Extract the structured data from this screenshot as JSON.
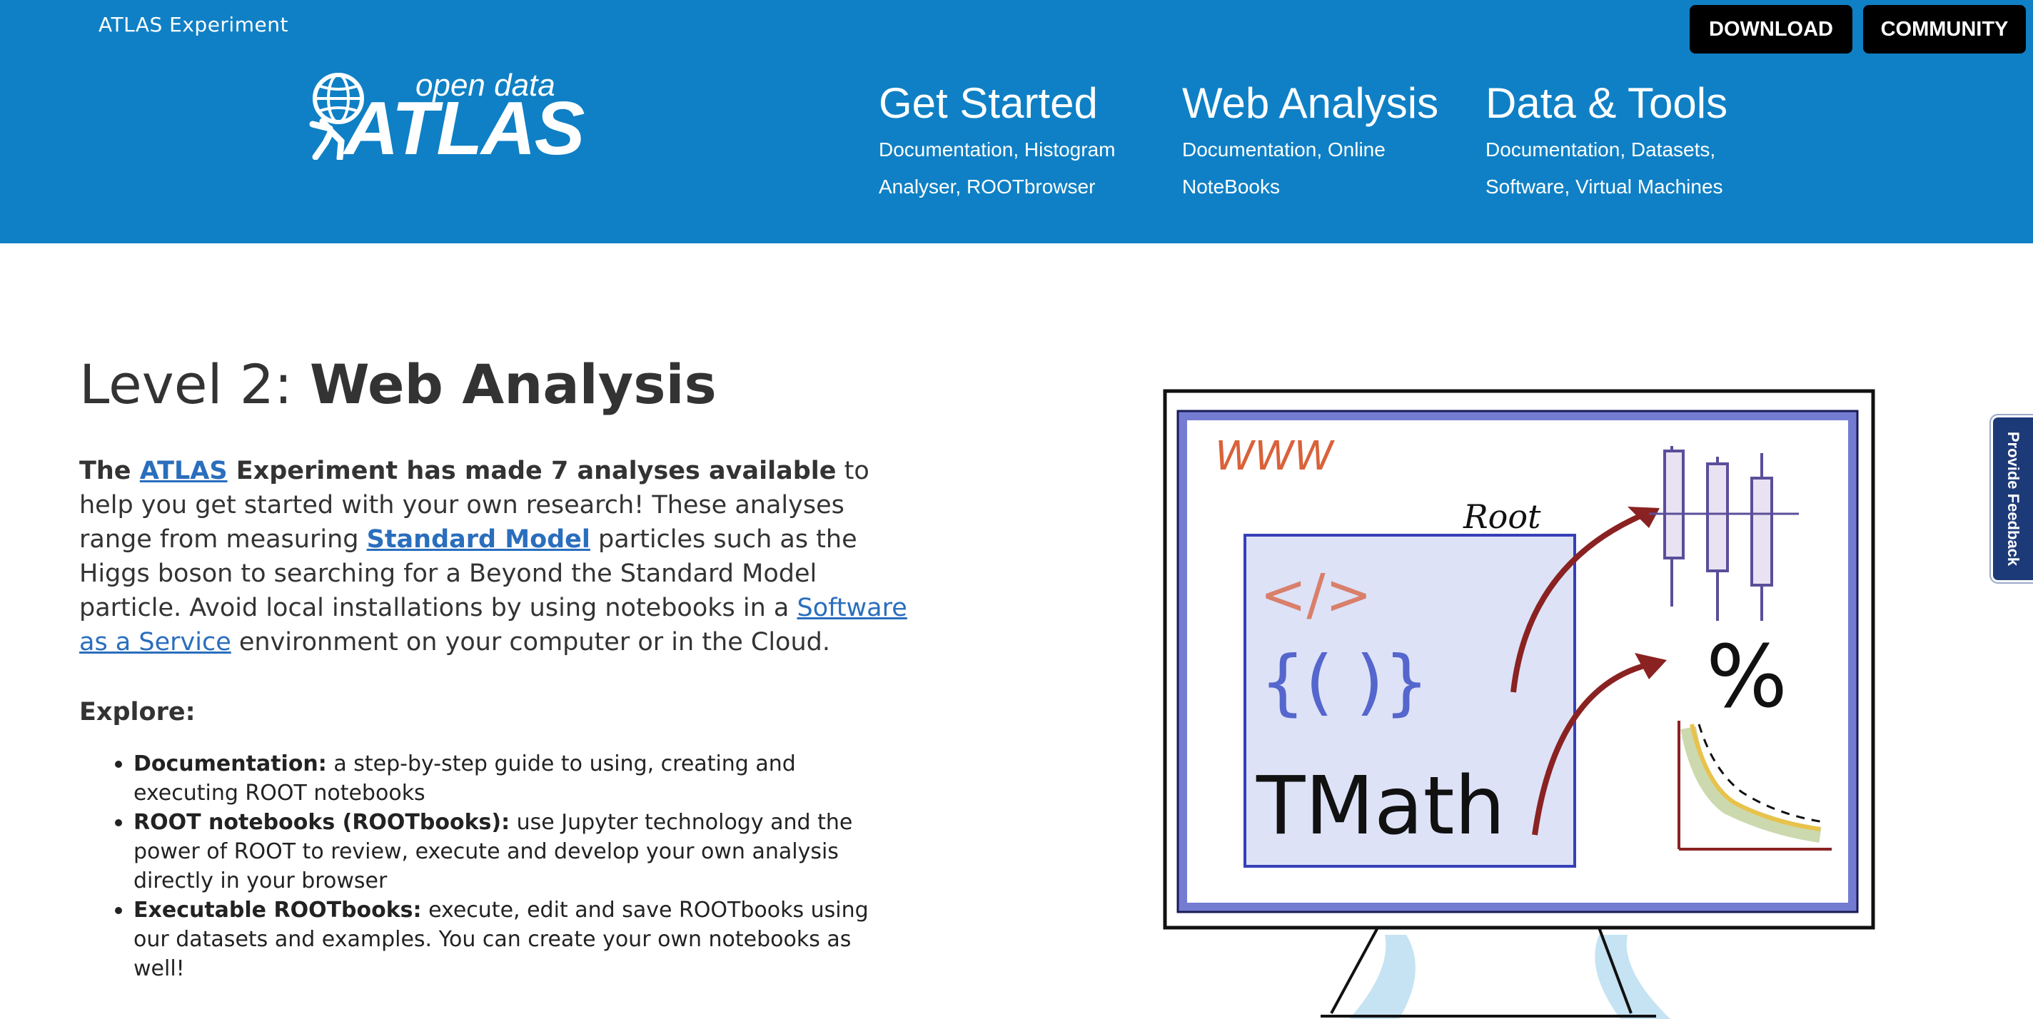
{
  "header": {
    "site_name": "ATLAS Experiment",
    "buttons": {
      "download": "DOWNLOAD",
      "community": "COMMUNITY"
    },
    "logo": {
      "open_data": "open data",
      "atlas": "ATLAS"
    },
    "nav": [
      {
        "title": "Get Started",
        "sub": "Documentation, Histogram Analyser, ROOTbrowser"
      },
      {
        "title": "Web Analysis",
        "sub": "Documentation, Online NoteBooks"
      },
      {
        "title": "Data & Tools",
        "sub": "Documentation, Datasets, Software, Virtual Machines"
      }
    ],
    "color": "#0f80c5"
  },
  "main": {
    "title_prefix": "Level 2: ",
    "title_bold": "Web Analysis",
    "intro": {
      "p1": "The ",
      "link_atlas": "ATLAS",
      "p2": " Experiment has made 7 analyses available",
      "p3": " to help you get started with your own research! These analyses range from measuring ",
      "link_sm": "Standard Model",
      "p4": " particles such as the Higgs boson to searching for a Beyond the Standard Model particle. Avoid local installations by using notebooks in a ",
      "link_saas": "Software as a Service",
      "p5": " environment on your computer or in the Cloud."
    },
    "explore_label": "Explore:",
    "bullets": [
      {
        "bold": "Documentation:",
        "text": " a step-by-step guide to using, creating and executing ROOT notebooks"
      },
      {
        "bold": "ROOT notebooks (ROOTbooks):",
        "text": " use Jupyter technology and the power of ROOT to review, execute and develop your own analysis directly in your browser"
      },
      {
        "bold": "Executable ROOTbooks:",
        "text": " execute, edit and save ROOTbooks using our datasets and examples. You can create your own notebooks as well!"
      }
    ],
    "link_color": "#2a6ebd"
  },
  "illustration": {
    "www": "WWW",
    "root": "Root",
    "code": "</>",
    "braces": "{( )}",
    "tmath": "TMath",
    "percent": "%"
  },
  "feedback": {
    "label": "Provide Feedback"
  }
}
